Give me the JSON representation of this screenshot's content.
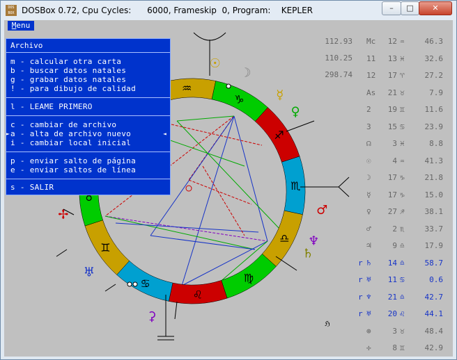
{
  "window": {
    "title": "DOSBox 0.72, Cpu Cycles:      6000, Frameskip  0, Program:    KEPLER",
    "icon_label": "DOS BOX"
  },
  "window_controls": {
    "minimize": "–",
    "maximize": "□",
    "close": "✕"
  },
  "menu": {
    "tab_first": "M",
    "tab_rest": "enu"
  },
  "dropdown": {
    "header": "Archivo",
    "items": [
      "m - calcular otra carta",
      "b - buscar datos natales",
      "g - grabar datos natales",
      "! - para dibujo de calidad",
      "l - LEAME PRIMERO",
      "c - cambiar de archivo",
      "a - alta de archivo nuevo",
      "i - cambiar local inicial",
      "p - enviar salto de página",
      "e - enviar saltos de línea",
      "s - SALIR"
    ],
    "selected_marker_left": "►",
    "selected_marker_right": "◄"
  },
  "cusps": [
    "112.93",
    "110.25",
    "298.74"
  ],
  "positions": [
    {
      "retro": "",
      "planet": "Mc",
      "deg": "12",
      "sign": "♒",
      "pos": "46.3",
      "color": "gray"
    },
    {
      "retro": "",
      "planet": "11",
      "deg": "13",
      "sign": "♓",
      "pos": "32.6",
      "color": "gray"
    },
    {
      "retro": "",
      "planet": "12",
      "deg": "17",
      "sign": "♈",
      "pos": "27.2",
      "color": "gray"
    },
    {
      "retro": "",
      "planet": "As",
      "deg": "21",
      "sign": "♉",
      "pos": "7.9",
      "color": "gray"
    },
    {
      "retro": "",
      "planet": "2",
      "deg": "19",
      "sign": "♊",
      "pos": "11.6",
      "color": "gray"
    },
    {
      "retro": "",
      "planet": "3",
      "deg": "15",
      "sign": "♋",
      "pos": "23.9",
      "color": "gray"
    },
    {
      "retro": "",
      "planet": "☊",
      "deg": "3",
      "sign": "♓",
      "pos": "8.8",
      "color": "gray"
    },
    {
      "retro": "",
      "planet": "☉",
      "deg": "4",
      "sign": "♒",
      "pos": "41.3",
      "color": "gray"
    },
    {
      "retro": "",
      "planet": "☽",
      "deg": "17",
      "sign": "♑",
      "pos": "21.8",
      "color": "gray"
    },
    {
      "retro": "",
      "planet": "☿",
      "deg": "17",
      "sign": "♑",
      "pos": "15.0",
      "color": "gray"
    },
    {
      "retro": "",
      "planet": "♀",
      "deg": "27",
      "sign": "♐",
      "pos": "38.1",
      "color": "gray"
    },
    {
      "retro": "",
      "planet": "♂",
      "deg": "2",
      "sign": "♏",
      "pos": "33.7",
      "color": "gray"
    },
    {
      "retro": "",
      "planet": "♃",
      "deg": "9",
      "sign": "♎",
      "pos": "17.9",
      "color": "gray"
    },
    {
      "retro": "r",
      "planet": "♄",
      "deg": "14",
      "sign": "♎",
      "pos": "58.7",
      "color": "blue"
    },
    {
      "retro": "r",
      "planet": "♅",
      "deg": "11",
      "sign": "♋",
      "pos": "0.6",
      "color": "blue"
    },
    {
      "retro": "r",
      "planet": "♆",
      "deg": "21",
      "sign": "♎",
      "pos": "42.7",
      "color": "blue"
    },
    {
      "retro": "r",
      "planet": "♅",
      "deg": "20",
      "sign": "♌",
      "pos": "44.1",
      "color": "blue"
    },
    {
      "retro": "",
      "planet": "⊕",
      "deg": "3",
      "sign": "♉",
      "pos": "48.4",
      "color": "gray"
    },
    {
      "retro": "",
      "planet": "✢",
      "deg": "8",
      "sign": "♊",
      "pos": "42.9",
      "color": "gray"
    }
  ],
  "wheel": {
    "signs": [
      {
        "glyph": "♒",
        "color": "#c8a000"
      },
      {
        "glyph": "♑",
        "color": "#00cc00"
      },
      {
        "glyph": "♐",
        "color": "#cc0000"
      },
      {
        "glyph": "♏",
        "color": "#00a0d0"
      },
      {
        "glyph": "♎",
        "color": "#c8a000"
      },
      {
        "glyph": "♍",
        "color": "#00cc00"
      },
      {
        "glyph": "♌",
        "color": "#cc0000"
      },
      {
        "glyph": "♋",
        "color": "#00a0d0"
      },
      {
        "glyph": "♊",
        "color": "#c8a000"
      },
      {
        "glyph": "♉",
        "color": "#00cc00"
      }
    ],
    "planets": [
      {
        "glyph": "☉",
        "color": "#c8a000"
      },
      {
        "glyph": "☽",
        "color": "#808080"
      },
      {
        "glyph": "☿",
        "color": "#c8a000"
      },
      {
        "glyph": "♀",
        "color": "#00aa00"
      },
      {
        "glyph": "♂",
        "color": "#cc0000"
      },
      {
        "glyph": "♆",
        "color": "#8000c0"
      },
      {
        "glyph": "♄",
        "color": "#808000"
      },
      {
        "glyph": "♅",
        "color": "#1633c7"
      },
      {
        "glyph": "⚳",
        "color": "#8000c0"
      },
      {
        "glyph": "✢",
        "color": "#cc0000"
      }
    ],
    "signature": "ℌ"
  }
}
